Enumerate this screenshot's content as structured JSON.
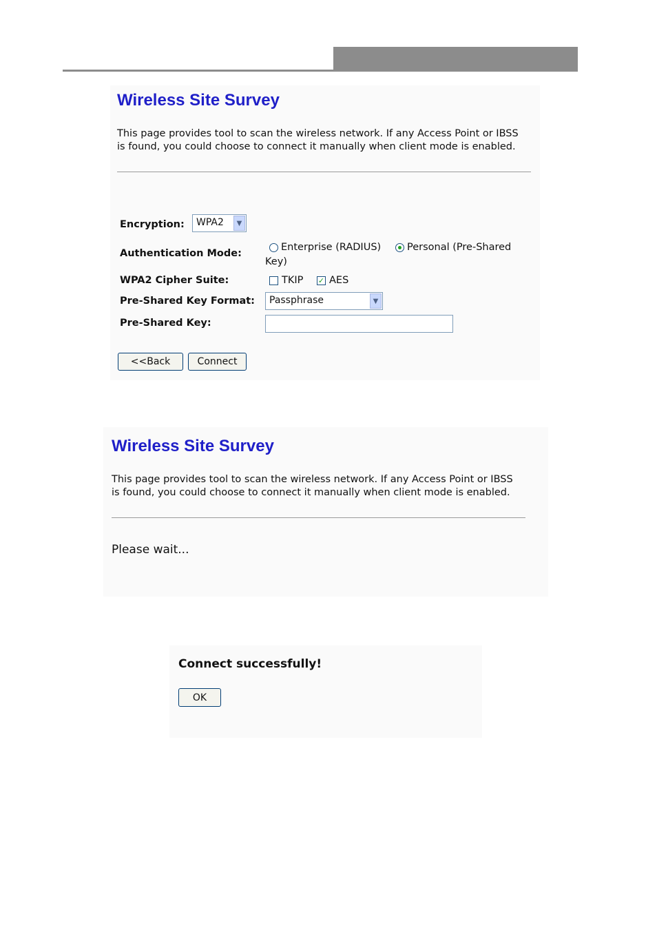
{
  "survey_form": {
    "title": "Wireless Site Survey",
    "description": "This page provides tool to scan the wireless network. If any Access Point or IBSS is found, you could choose to connect it manually when client mode is enabled.",
    "encryption": {
      "label": "Encryption:",
      "value": "WPA2"
    },
    "auth_mode": {
      "label": "Authentication Mode:",
      "option_enterprise": "Enterprise (RADIUS)",
      "option_personal": "Personal (Pre-Shared",
      "option_personal_cont": "Key)",
      "selected": "Personal (Pre-Shared Key)"
    },
    "cipher": {
      "label": "WPA2 Cipher Suite:",
      "tkip": "TKIP",
      "aes": "AES",
      "tkip_checked": false,
      "aes_checked": true
    },
    "psk_format": {
      "label": "Pre-Shared Key Format:",
      "value": "Passphrase"
    },
    "psk": {
      "label": "Pre-Shared Key:",
      "value": ""
    },
    "back_label": "<<Back",
    "connect_label": "Connect"
  },
  "wait_page": {
    "title": "Wireless Site Survey",
    "description": "This page provides tool to scan the wireless network. If any Access Point or IBSS is found, you could choose to connect it manually when client mode is enabled.",
    "message": "Please wait..."
  },
  "success_page": {
    "message": "Connect successfully!",
    "ok_label": "OK"
  },
  "colors": {
    "title": "#1f1fc8",
    "header_bar": "#8c8c8c",
    "check_mark": "#21a121"
  }
}
